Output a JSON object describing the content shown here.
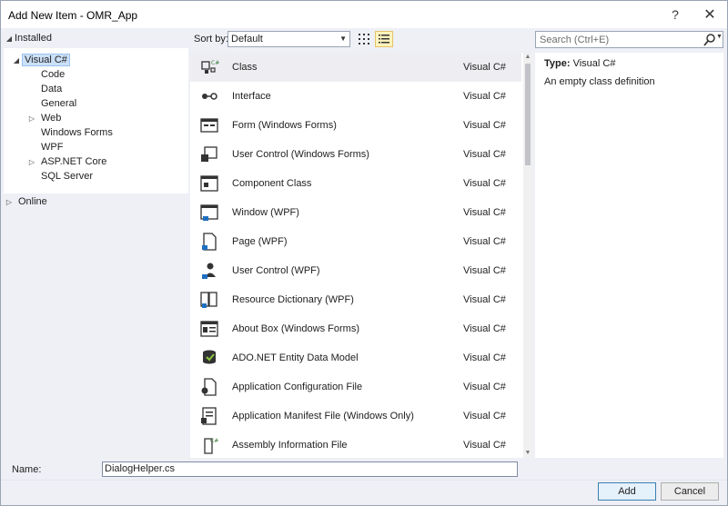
{
  "window": {
    "title": "Add New Item - OMR_App",
    "help_glyph": "?",
    "close_glyph": "✕"
  },
  "tree": {
    "installed": "Installed",
    "items": [
      {
        "label": "Visual C#",
        "expanded": true,
        "selected": true,
        "indent": 0
      },
      {
        "label": "Code",
        "indent": 1
      },
      {
        "label": "Data",
        "indent": 1
      },
      {
        "label": "General",
        "indent": 1
      },
      {
        "label": "Web",
        "indent": 1,
        "collapsed": true
      },
      {
        "label": "Windows Forms",
        "indent": 1
      },
      {
        "label": "WPF",
        "indent": 1
      },
      {
        "label": "ASP.NET Core",
        "indent": 1,
        "collapsed": true
      },
      {
        "label": "SQL Server",
        "indent": 1
      }
    ],
    "online": "Online"
  },
  "sort": {
    "label": "Sort by:",
    "value": "Default"
  },
  "search": {
    "placeholder": "Search (Ctrl+E)"
  },
  "templates": [
    {
      "name": "Class",
      "lang": "Visual C#",
      "icon": "class-icon",
      "selected": true
    },
    {
      "name": "Interface",
      "lang": "Visual C#",
      "icon": "interface-icon"
    },
    {
      "name": "Form (Windows Forms)",
      "lang": "Visual C#",
      "icon": "form-icon"
    },
    {
      "name": "User Control (Windows Forms)",
      "lang": "Visual C#",
      "icon": "user-control-icon"
    },
    {
      "name": "Component Class",
      "lang": "Visual C#",
      "icon": "component-class-icon"
    },
    {
      "name": "Window (WPF)",
      "lang": "Visual C#",
      "icon": "wpf-window-icon"
    },
    {
      "name": "Page (WPF)",
      "lang": "Visual C#",
      "icon": "wpf-page-icon"
    },
    {
      "name": "User Control (WPF)",
      "lang": "Visual C#",
      "icon": "wpf-user-control-icon"
    },
    {
      "name": "Resource Dictionary (WPF)",
      "lang": "Visual C#",
      "icon": "resource-dictionary-icon"
    },
    {
      "name": "About Box (Windows Forms)",
      "lang": "Visual C#",
      "icon": "about-box-icon"
    },
    {
      "name": "ADO.NET Entity Data Model",
      "lang": "Visual C#",
      "icon": "entity-data-model-icon"
    },
    {
      "name": "Application Configuration File",
      "lang": "Visual C#",
      "icon": "config-file-icon"
    },
    {
      "name": "Application Manifest File (Windows Only)",
      "lang": "Visual C#",
      "icon": "manifest-file-icon"
    },
    {
      "name": "Assembly Information File",
      "lang": "Visual C#",
      "icon": "assembly-info-icon"
    }
  ],
  "details": {
    "type_label": "Type:",
    "type_value": "Visual C#",
    "description": "An empty class definition"
  },
  "name_field": {
    "label": "Name:",
    "value": "DialogHelper.cs"
  },
  "buttons": {
    "add": "Add",
    "cancel": "Cancel"
  },
  "colors": {
    "selection": "#cce0f7",
    "accent": "#3c7fb1",
    "dialog_bg": "#eef0f6"
  }
}
